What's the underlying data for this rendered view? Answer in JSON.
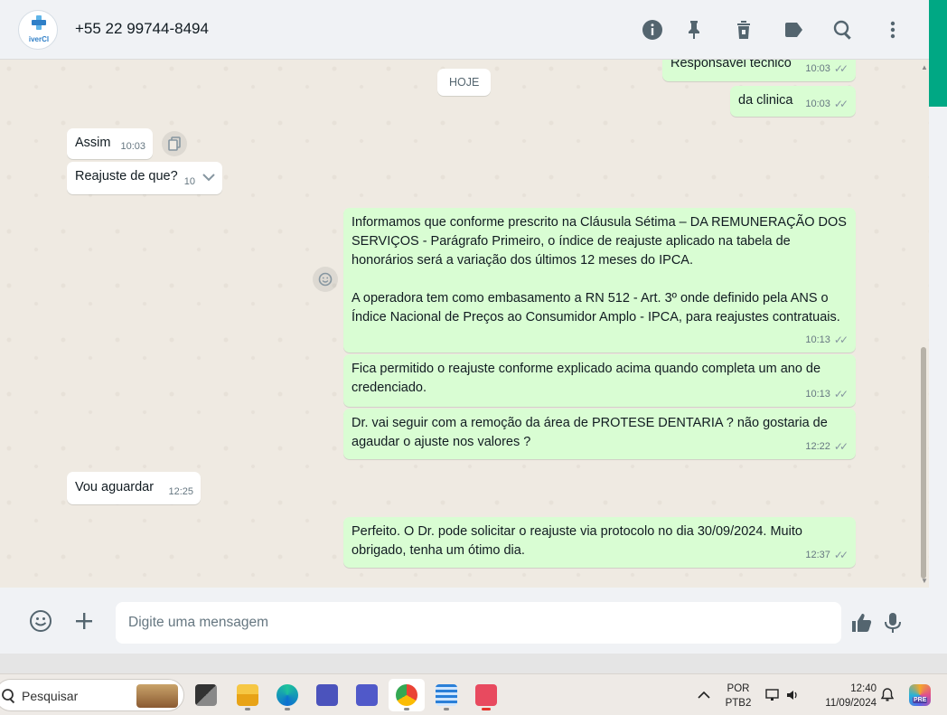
{
  "header": {
    "avatar_text": "iverCl",
    "contact": "+55 22 99744-8494",
    "icons": [
      "info-icon",
      "pin-icon",
      "delete-icon",
      "label-icon",
      "search-icon",
      "menu-icon"
    ]
  },
  "chat": {
    "date_chip": "HOJE",
    "messages": [
      {
        "dir": "out",
        "text": "Responsavel tecnico",
        "time": "10:03"
      },
      {
        "dir": "out",
        "text": "da clinica",
        "time": "10:03"
      },
      {
        "dir": "in",
        "text": "Assim",
        "time": "10:03"
      },
      {
        "dir": "in",
        "text": "Reajuste de que?",
        "time": "10"
      },
      {
        "dir": "out",
        "text": "Informamos que conforme prescrito na Cláusula Sétima – DA REMUNERAÇÃO DOS SERVIÇOS - Parágrafo Primeiro, o índice de reajuste aplicado na tabela de honorários será a variação dos últimos 12 meses do IPCA.\n\nA operadora tem como embasamento a RN 512 - Art. 3º onde definido pela ANS o Índice Nacional de Preços ao Consumidor Amplo - IPCA, para reajustes contratuais.",
        "time": "10:13"
      },
      {
        "dir": "out",
        "text": "Fica permitido o reajuste conforme explicado acima quando completa um ano de credenciado.",
        "time": "10:13"
      },
      {
        "dir": "out",
        "text": "Dr. vai seguir com a remoção da área de PROTESE DENTARIA ? não gostaria de agaudar o ajuste nos valores ?",
        "time": "12:22"
      },
      {
        "dir": "in",
        "text": "Vou aguardar",
        "time": "12:25"
      },
      {
        "dir": "out",
        "text": "Perfeito. O Dr. pode solicitar o reajuste via protocolo no dia 30/09/2024. Muito obrigado, tenha um ótimo dia.",
        "time": "12:37"
      }
    ]
  },
  "composer": {
    "placeholder": "Digite uma mensagem"
  },
  "taskbar": {
    "search_text": "Pesquisar",
    "lang_top": "POR",
    "lang_bottom": "PTB2",
    "clock_time": "12:40",
    "clock_date": "11/09/2024",
    "copilot_badge": "PRE"
  },
  "colors": {
    "chat_bg": "#efeae2",
    "bubble_out": "#d9fdd3",
    "bubble_in": "#ffffff",
    "accent": "#00a884"
  }
}
